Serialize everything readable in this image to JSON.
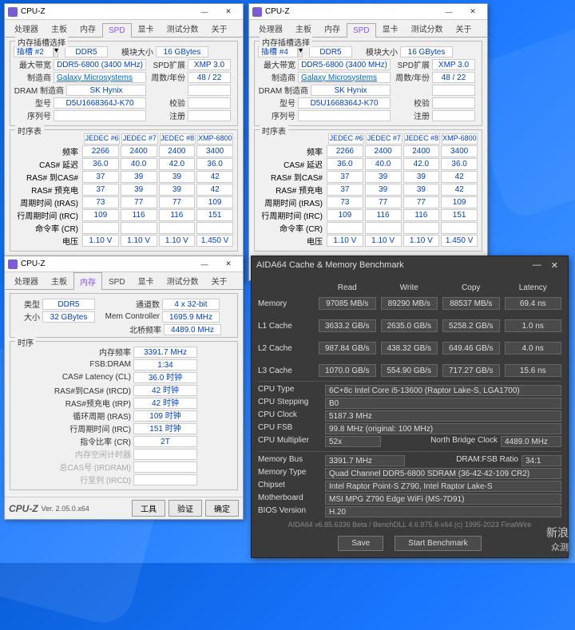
{
  "cpuz": {
    "title": "CPU-Z",
    "version": "Ver. 2.05.0.x64",
    "tabs": [
      "处理器",
      "主板",
      "内存",
      "SPD",
      "显卡",
      "测试分数",
      "关于"
    ],
    "btns": {
      "tools": "工具",
      "validate": "验证",
      "ok": "确定"
    }
  },
  "spd": {
    "activeTab": "SPD",
    "slotSel": "内存插槽选择",
    "slot2": "插槽  #2",
    "slot4": "插槽  #4",
    "memType": "DDR5",
    "modSizeL": "模块大小",
    "modSize": "16 GBytes",
    "maxBwL": "最大带宽",
    "maxBw": "DDR5-6800 (3400 MHz)",
    "spdExtL": "SPD扩展",
    "spdExt": "XMP 3.0",
    "mfrL": "制造商",
    "mfr": "Galaxy Microsystems Ltd.",
    "weekL": "周数/年份",
    "week": "48 / 22",
    "dramMfrL": "DRAM 制造商",
    "dramMfr": "SK Hynix",
    "rankL": "",
    "modelL": "型号",
    "model": "D5U1668364J-K70",
    "checkL": "校验",
    "serialL": "序列号",
    "regL": "注册",
    "timingTitle": "时序表",
    "cols": [
      "JEDEC #6",
      "JEDEC #7",
      "JEDEC #8",
      "XMP-6800"
    ],
    "rows": [
      {
        "l": "频率",
        "v": [
          "2266 MHz",
          "2400 MHz",
          "2400 MHz",
          "3400 MHz"
        ]
      },
      {
        "l": "CAS# 延迟",
        "v": [
          "36.0",
          "40.0",
          "42.0",
          "36.0"
        ]
      },
      {
        "l": "RAS# 到CAS#",
        "v": [
          "37",
          "39",
          "39",
          "42"
        ]
      },
      {
        "l": "RAS# 预充电",
        "v": [
          "37",
          "39",
          "39",
          "42"
        ]
      },
      {
        "l": "周期时间 (tRAS)",
        "v": [
          "73",
          "77",
          "77",
          "109"
        ]
      },
      {
        "l": "行周期时间 (tRC)",
        "v": [
          "109",
          "116",
          "116",
          "151"
        ]
      },
      {
        "l": "命令率 (CR)",
        "v": [
          "",
          "",
          "",
          ""
        ]
      },
      {
        "l": "电压",
        "v": [
          "1.10 V",
          "1.10 V",
          "1.10 V",
          "1.450 V"
        ]
      }
    ]
  },
  "mem": {
    "activeTab": "内存",
    "typeL": "类型",
    "type": "DDR5",
    "chanL": "通道数",
    "chan": "4 x 32-bit",
    "sizeL": "大小",
    "size": "32 GBytes",
    "mcL": "Mem Controller",
    "mc": "1695.9 MHz",
    "nbL": "北桥频率",
    "nb": "4489.0 MHz",
    "timingTitle": "时序",
    "rows": [
      {
        "l": "内存频率",
        "v": "3391.7 MHz"
      },
      {
        "l": "FSB:DRAM",
        "v": "1:34"
      },
      {
        "l": "CAS# Latency (CL)",
        "v": "36.0 时钟"
      },
      {
        "l": "RAS#到CAS# (tRCD)",
        "v": "42 时钟"
      },
      {
        "l": "RAS#预充电 (tRP)",
        "v": "42 时钟"
      },
      {
        "l": "循环周期 (tRAS)",
        "v": "109 时钟"
      },
      {
        "l": "行周期时间 (tRC)",
        "v": "151 时钟"
      },
      {
        "l": "指令比率 (CR)",
        "v": "2T"
      },
      {
        "l": "内存空闲计时器",
        "v": ""
      },
      {
        "l": "总CAS号 (tRDRAM)",
        "v": ""
      },
      {
        "l": "行至列 (tRCD)",
        "v": ""
      }
    ]
  },
  "aida": {
    "title": "AIDA64 Cache & Memory Benchmark",
    "hdr": [
      "Read",
      "Write",
      "Copy",
      "Latency"
    ],
    "rows": [
      {
        "l": "Memory",
        "v": [
          "97085 MB/s",
          "89290 MB/s",
          "88537 MB/s",
          "69.4 ns"
        ]
      },
      {
        "l": "L1 Cache",
        "v": [
          "3633.2 GB/s",
          "2635.0 GB/s",
          "5258.2 GB/s",
          "1.0 ns"
        ]
      },
      {
        "l": "L2 Cache",
        "v": [
          "987.84 GB/s",
          "438.32 GB/s",
          "649.46 GB/s",
          "4.0 ns"
        ]
      },
      {
        "l": "L3 Cache",
        "v": [
          "1070.0 GB/s",
          "554.90 GB/s",
          "717.27 GB/s",
          "15.6 ns"
        ]
      }
    ],
    "info": [
      {
        "l": "CPU Type",
        "v": "6C+8c Intel Core i5-13600 (Raptor Lake-S, LGA1700)"
      },
      {
        "l": "CPU Stepping",
        "v": "B0"
      },
      {
        "l": "CPU Clock",
        "v": "5187.3 MHz"
      },
      {
        "l": "CPU FSB",
        "v": "99.8 MHz   (original: 100 MHz)"
      }
    ],
    "mul": {
      "l": "CPU Multiplier",
      "v": "52x",
      "nbL": "North Bridge Clock",
      "nb": "4489.0 MHz"
    },
    "info2": [
      {
        "l": "Memory Bus",
        "v": "3391.7 MHz",
        "rL": "DRAM:FSB Ratio",
        "rv": "34:1"
      },
      {
        "l": "Memory Type",
        "v": "Quad Channel DDR5-6800 SDRAM   (36-42-42-109 CR2)"
      },
      {
        "l": "Chipset",
        "v": "Intel Raptor Point-S Z790, Intel Raptor Lake-S"
      },
      {
        "l": "Motherboard",
        "v": "MSI MPG Z790 Edge WiFi (MS-7D91)"
      },
      {
        "l": "BIOS Version",
        "v": "H.20"
      }
    ],
    "copy": "AIDA64 v6.85.6336 Beta / BenchDLL 4.6.875.8-x64   (c) 1995-2023 FinalWire",
    "btns": {
      "save": "Save",
      "start": "Start Benchmark"
    }
  },
  "watermark": {
    "l1": "新浪",
    "l2": "众测"
  }
}
